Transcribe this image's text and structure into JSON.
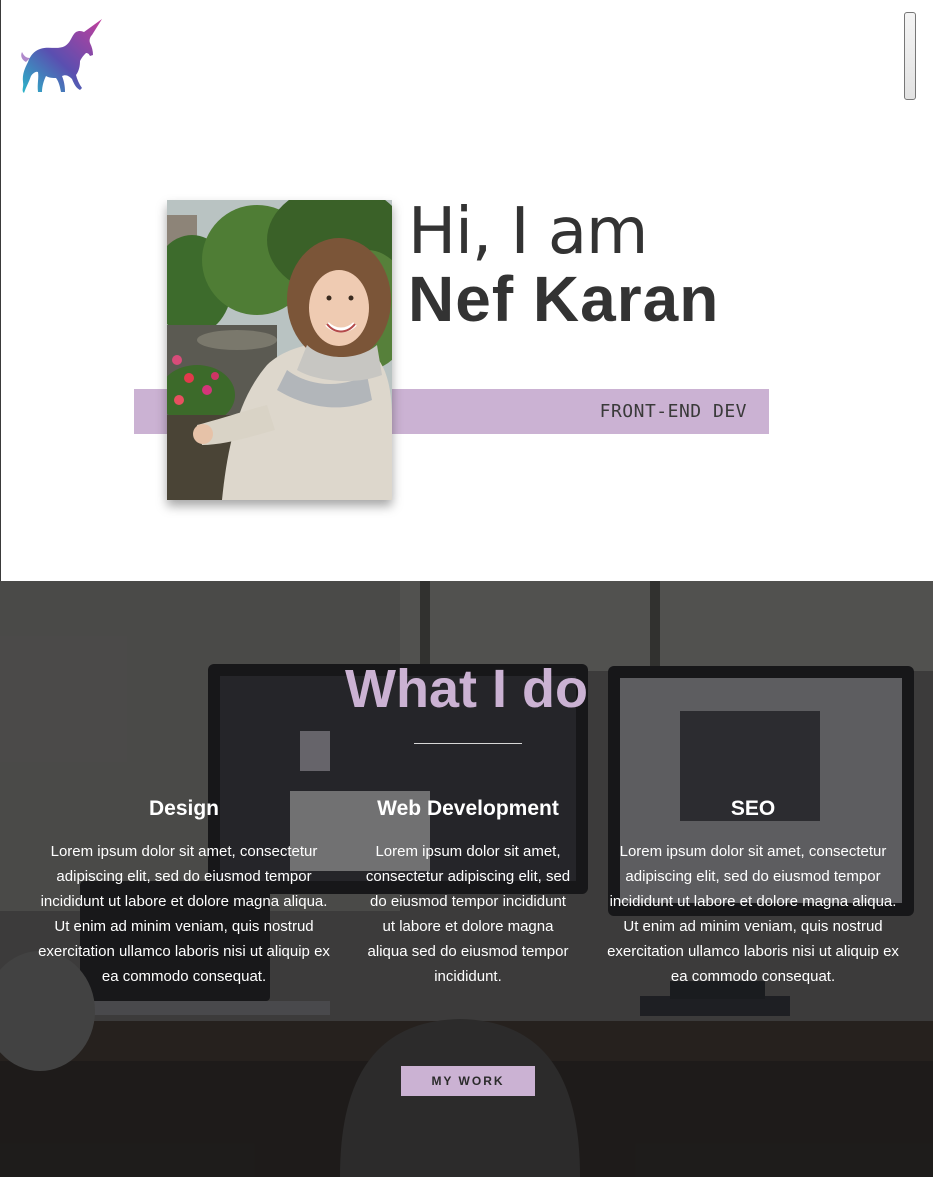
{
  "header": {
    "logo_icon": "unicorn-icon",
    "menu_icon": "menu-toggle-icon"
  },
  "hero": {
    "greeting": "Hi, I am",
    "name": "Nef Karan",
    "role": "FRONT-END DEV",
    "accent_color": "#cbb2d3"
  },
  "services": {
    "title": "What I do",
    "items": [
      {
        "heading": "Design",
        "text": "Lorem ipsum dolor sit amet, consectetur adipiscing elit, sed do eiusmod tempor incididunt ut labore et dolore magna aliqua. Ut enim ad minim veniam, quis nostrud exercitation ullamco laboris nisi ut aliquip ex ea commodo consequat."
      },
      {
        "heading": "Web Development",
        "text": "Lorem ipsum dolor sit amet, consectetur adipiscing elit, sed do eiusmod tempor incididunt ut labore et dolore magna aliqua sed do eiusmod tempor incididunt."
      },
      {
        "heading": "SEO",
        "text": "Lorem ipsum dolor sit amet, consectetur adipiscing elit, sed do eiusmod tempor incididunt ut labore et dolore magna aliqua. Ut enim ad minim veniam, quis nostrud exercitation ullamco laboris nisi ut aliquip ex ea commodo consequat."
      }
    ],
    "button_label": "MY WORK"
  }
}
